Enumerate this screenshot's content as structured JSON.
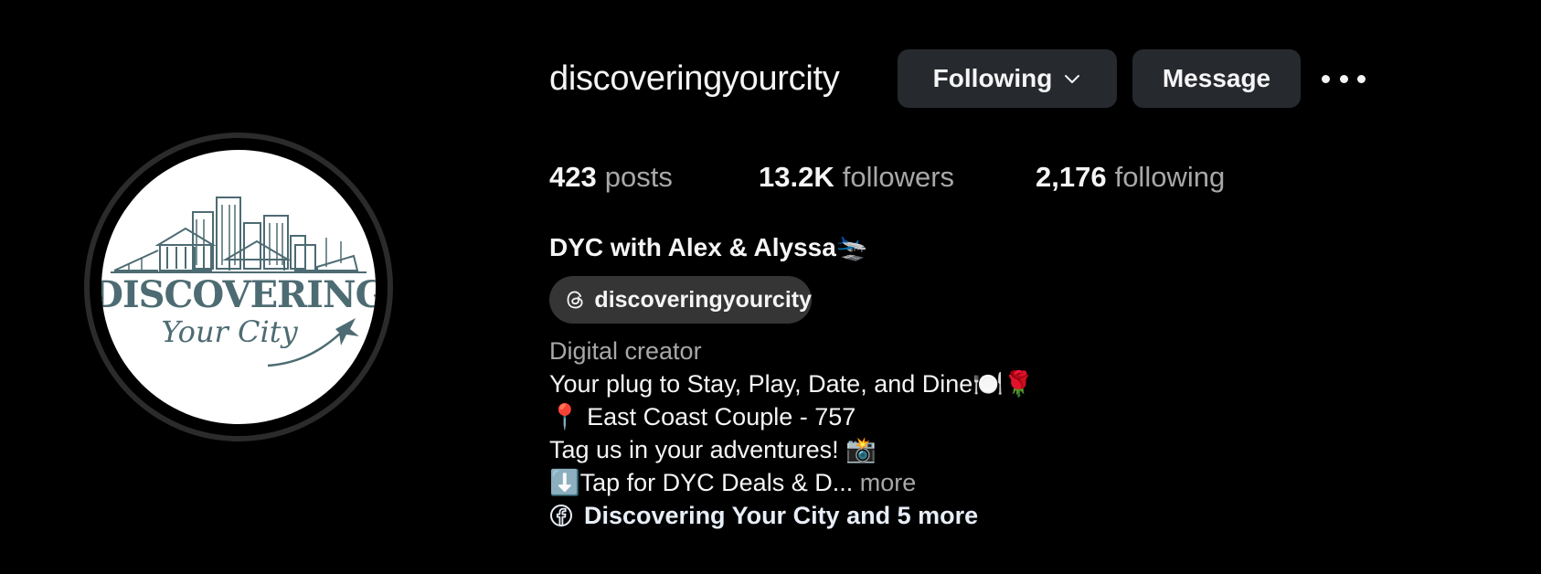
{
  "profile": {
    "username": "discoveringyourcity",
    "full_name": "DYC with Alex & Alyssa🛬",
    "threads_handle": "discoveringyourcity",
    "avatar": {
      "logo_line1": "DISCOVERING",
      "logo_line2": "Your City"
    }
  },
  "actions": {
    "following_label": "Following",
    "message_label": "Message"
  },
  "stats": {
    "posts_count": "423",
    "posts_label": "posts",
    "followers_count": "13.2K",
    "followers_label": "followers",
    "following_count": "2,176",
    "following_label": "following"
  },
  "bio": {
    "category": "Digital creator",
    "line1": "Your plug to Stay, Play, Date, and Dine🍽️🌹",
    "line2": "📍 East Coast Couple - 757",
    "line3": "Tag us in your adventures! 📸",
    "line4": "⬇️Tap for DYC Deals & D...",
    "more_label": "more",
    "links_label": "Discovering Your City and 5 more"
  },
  "icons": {
    "following_chevron": "chevron-down-icon",
    "more_options": "more-horizontal-icon",
    "threads": "threads-icon",
    "links": "facebook-icon"
  },
  "colors": {
    "background": "#000000",
    "button": "#26292e",
    "pill": "#353535",
    "secondary_text": "#a8a8a8",
    "logo_teal": "#4d6b72"
  }
}
